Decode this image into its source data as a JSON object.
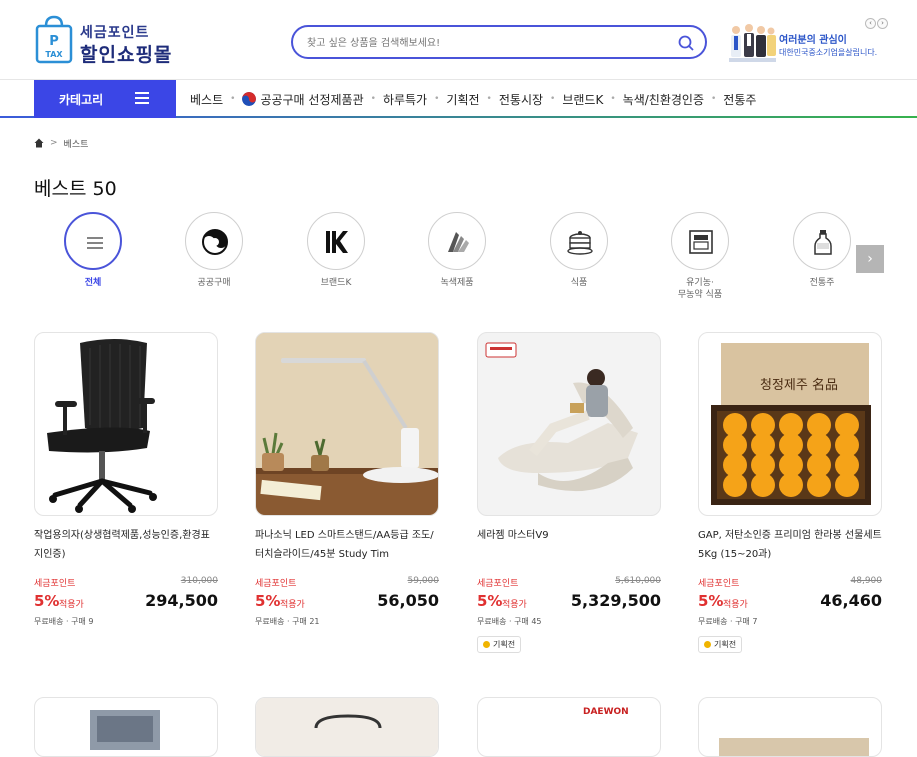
{
  "logo": {
    "line1": "세금포인트",
    "line2": "할인쇼핑몰",
    "bag_text1": "P",
    "bag_text2": "TAX"
  },
  "search": {
    "placeholder": "찾고 싶은 상품을 검색해보세요!"
  },
  "promo": {
    "line1": "여러분의 관심이",
    "line2": "대한민국중소기업을살립니다."
  },
  "gnb": {
    "category_label": "카테고리",
    "items": [
      "베스트",
      "공공구매 선정제품관",
      "하루특가",
      "기획전",
      "전통시장",
      "브랜드K",
      "녹색/친환경인증",
      "전통주"
    ]
  },
  "breadcrumb": {
    "current": "베스트"
  },
  "page_title": "베스트 50",
  "categories": [
    {
      "label": "전체",
      "icon": "menu-icon"
    },
    {
      "label": "공공구매",
      "icon": "taegeuk-icon"
    },
    {
      "label": "브랜드K",
      "icon": "brand-k-icon"
    },
    {
      "label": "녹색제품",
      "icon": "green-leaf-icon"
    },
    {
      "label": "식품",
      "icon": "cake-icon"
    },
    {
      "label": "유기농·",
      "label2": "무농약 식품",
      "icon": "organic-box-icon"
    },
    {
      "label": "전통주",
      "icon": "bottle-icon"
    }
  ],
  "products": [
    {
      "name": "작업용의자(상생협력제품,성능인증,환경표지인증)",
      "point_label": "세금포인트",
      "orig": "310,000",
      "pct": "5%",
      "apply": "적용가",
      "price": "294,500",
      "ship": "무료배송 · 구매 9",
      "tag": ""
    },
    {
      "name": "파나소닉 LED 스마트스탠드/AA등급 조도/터치슬라이드/45분 Study Tim",
      "point_label": "세금포인트",
      "orig": "59,000",
      "pct": "5%",
      "apply": "적용가",
      "price": "56,050",
      "ship": "무료배송 · 구매 21",
      "tag": ""
    },
    {
      "name": "세라젬 마스터V9",
      "point_label": "세금포인트",
      "orig": "5,610,000",
      "pct": "5%",
      "apply": "적용가",
      "price": "5,329,500",
      "ship": "무료배송 · 구매 45",
      "tag": "기획전"
    },
    {
      "name": "GAP, 저탄소인증 프리미엄 한라봉 선물세트 5Kg (15~20과)",
      "point_label": "세금포인트",
      "orig": "48,900",
      "pct": "5%",
      "apply": "적용가",
      "price": "46,460",
      "ship": "무료배송 · 구매 7",
      "tag": "기획전"
    }
  ],
  "product_image_text": {
    "box_title": "청정제주 名品",
    "brand_label": "DAEWON"
  },
  "colors": {
    "accent": "#3b46e6",
    "discount": "#e03131"
  }
}
